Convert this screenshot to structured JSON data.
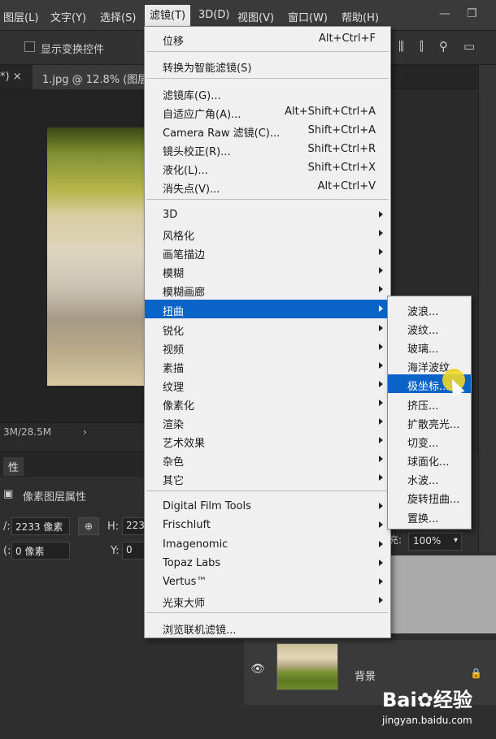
{
  "menubar": {
    "items": [
      {
        "label": "图层(L)"
      },
      {
        "label": "文字(Y)"
      },
      {
        "label": "选择(S)"
      },
      {
        "label": "滤镜(T)"
      },
      {
        "label": "3D(D)"
      },
      {
        "label": "视图(V)"
      },
      {
        "label": "窗口(W)"
      },
      {
        "label": "帮助(H)"
      }
    ],
    "minimize": "—",
    "restore": "❐"
  },
  "options_bar": {
    "show_transform_controls": "显示变换控件"
  },
  "document_tab": {
    "left_fragment": "*) ×",
    "title": "1.jpg @ 12.8% (图层"
  },
  "status_bar": {
    "doc_size": "3M/28.5M",
    "arrow": "›"
  },
  "properties_panel": {
    "tab": "性",
    "subtitle": "像素图层属性",
    "w_label": "/:",
    "w_value": "2233 像素",
    "link": "⊕",
    "h_label": "H:",
    "h_value": "223",
    "x_label": "(:",
    "x_value": "0 像素",
    "y_label": "Y:",
    "y_value": "0"
  },
  "layers_panel": {
    "fill_label": "充:",
    "fill_value": "100%",
    "layer_name": "背景"
  },
  "filter_menu": {
    "items": [
      {
        "label": "位移",
        "shortcut": "Alt+Ctrl+F"
      },
      {
        "label": "转换为智能滤镜(S)",
        "shortcut": ""
      },
      {
        "label": "滤镜库(G)...",
        "shortcut": ""
      },
      {
        "label": "自适应广角(A)...",
        "shortcut": "Alt+Shift+Ctrl+A"
      },
      {
        "label": "Camera Raw 滤镜(C)...",
        "shortcut": "Shift+Ctrl+A"
      },
      {
        "label": "镜头校正(R)...",
        "shortcut": "Shift+Ctrl+R"
      },
      {
        "label": "液化(L)...",
        "shortcut": "Shift+Ctrl+X"
      },
      {
        "label": "消失点(V)...",
        "shortcut": "Alt+Ctrl+V"
      },
      {
        "label": "3D"
      },
      {
        "label": "风格化"
      },
      {
        "label": "画笔描边"
      },
      {
        "label": "模糊"
      },
      {
        "label": "模糊画廊"
      },
      {
        "label": "扭曲"
      },
      {
        "label": "锐化"
      },
      {
        "label": "视频"
      },
      {
        "label": "素描"
      },
      {
        "label": "纹理"
      },
      {
        "label": "像素化"
      },
      {
        "label": "渲染"
      },
      {
        "label": "艺术效果"
      },
      {
        "label": "杂色"
      },
      {
        "label": "其它"
      },
      {
        "label": "Digital Film Tools"
      },
      {
        "label": "Frischluft"
      },
      {
        "label": "Imagenomic"
      },
      {
        "label": "Topaz Labs"
      },
      {
        "label": "Vertus™"
      },
      {
        "label": "光束大师"
      },
      {
        "label": "浏览联机滤镜..."
      }
    ]
  },
  "distort_submenu": {
    "items": [
      {
        "label": "波浪..."
      },
      {
        "label": "波纹..."
      },
      {
        "label": "玻璃..."
      },
      {
        "label": "海洋波纹..."
      },
      {
        "label": "极坐标..."
      },
      {
        "label": "挤压..."
      },
      {
        "label": "扩散亮光..."
      },
      {
        "label": "切变..."
      },
      {
        "label": "球面化..."
      },
      {
        "label": "水波..."
      },
      {
        "label": "旋转扭曲..."
      },
      {
        "label": "置换..."
      }
    ]
  },
  "watermark": {
    "logo": "Bai✿经验",
    "url": "jingyan.baidu.com"
  },
  "colors": {
    "highlight": "#0a64c8",
    "menu_bg": "#f0f0f0",
    "app_bg": "#2b2b2b"
  }
}
